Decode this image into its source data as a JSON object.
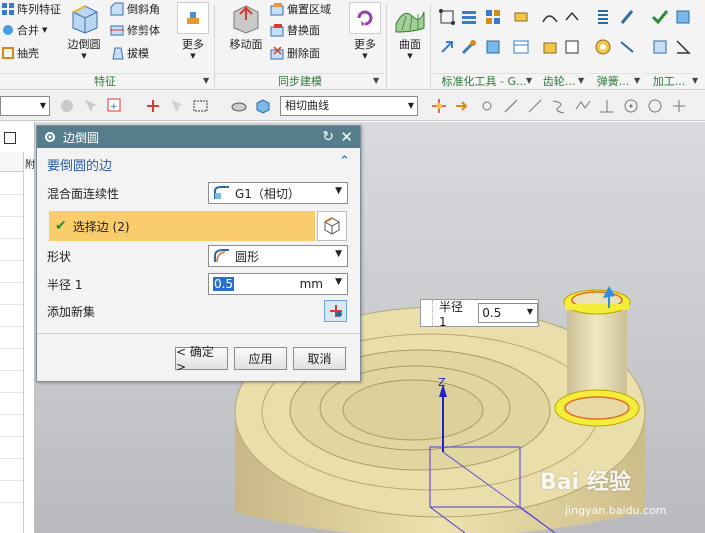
{
  "ribbon": {
    "feature_group": {
      "array_feature": "阵列特征",
      "merge": "合并",
      "shell": "抽壳",
      "edge_blend": "边倒圆",
      "chamfer": "倒斜角",
      "trim_body": "修剪体",
      "draft": "拔模",
      "more": "更多",
      "group_label": "特征"
    },
    "sync_group": {
      "move_face": "移动面",
      "offset_region": "偏置区域",
      "replace_face": "替换面",
      "delete_face": "删除面",
      "more": "更多",
      "group_label": "同步建模"
    },
    "surface": {
      "label": "曲面"
    },
    "extra_groups": {
      "standard_parts": "标准化工具 - G...",
      "gear": "齿轮...",
      "spring": "弹簧...",
      "machining": "加工..."
    }
  },
  "toolbar": {
    "filter_value": "",
    "curve_rule": "相切曲线"
  },
  "navigator": {
    "col_label": "附"
  },
  "dialog": {
    "title": "边倒圆",
    "section_title": "要倒圆的边",
    "continuity_label": "混合面连续性",
    "continuity_value": "G1（相切）",
    "select_edge_label": "选择边 (2)",
    "shape_label": "形状",
    "shape_value": "圆形",
    "radius_label": "半径 1",
    "radius_value": "0.5",
    "radius_unit": "mm",
    "add_new_set_label": "添加新集",
    "ok_button": "< 确定 >",
    "apply_button": "应用",
    "cancel_button": "取消"
  },
  "viewport": {
    "float_label": "半径 1",
    "float_value": "0.5",
    "axis_z": "Z",
    "watermark_brand": "Bai 经验",
    "watermark_url": "jingyan.baidu.com"
  },
  "colors": {
    "dialog_title_bg": "#567d8c",
    "selected_row_bg": "#f9cd6b",
    "group_label_green": "#2d7a3a",
    "part_body": "#e8dca3",
    "selected_edge": "#f2ee20"
  }
}
